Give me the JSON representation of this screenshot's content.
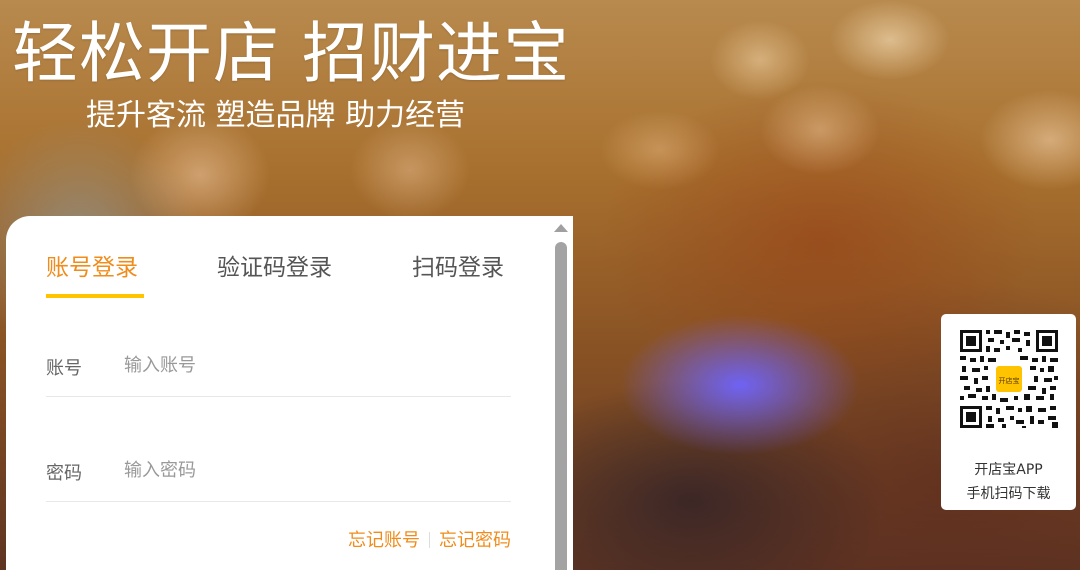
{
  "hero": {
    "title": "轻松开店  招财进宝",
    "subtitle": "提升客流 塑造品牌 助力经营"
  },
  "login": {
    "tabs": [
      {
        "label": "账号登录",
        "active": true
      },
      {
        "label": "验证码登录",
        "active": false
      },
      {
        "label": "扫码登录",
        "active": false
      }
    ],
    "account": {
      "label": "账号",
      "placeholder": "输入账号",
      "value": ""
    },
    "password": {
      "label": "密码",
      "placeholder": "输入密码",
      "value": ""
    },
    "forgot_account": "忘记账号",
    "forgot_password": "忘记密码"
  },
  "qr": {
    "logo_text": "开店宝",
    "caption_line1": "开店宝APP",
    "caption_line2": "手机扫码下载"
  },
  "colors": {
    "accent": "#f08c1b",
    "tab_underline": "#ffc300"
  },
  "icons": {
    "scroll_up": "triangle-up-icon",
    "qr": "qr-code-icon"
  }
}
